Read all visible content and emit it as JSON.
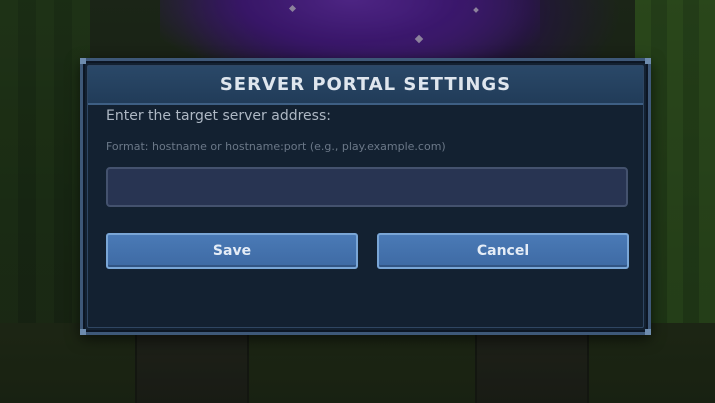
{
  "dialog": {
    "title": "SERVER PORTAL SETTINGS",
    "prompt": "Enter the target server address:",
    "hint": "Format: hostname or hostname:port (e.g., play.example.com)",
    "address_input": {
      "value": "",
      "placeholder": ""
    },
    "buttons": {
      "save_label": "Save",
      "cancel_label": "Cancel"
    }
  },
  "colors": {
    "dialog_background": "#132131",
    "title_bar": "#213c59",
    "button_fill": "#3e6aa4",
    "button_border": "#7aa6d6",
    "input_fill": "#283452",
    "portal_purple": "#5a22a8"
  }
}
